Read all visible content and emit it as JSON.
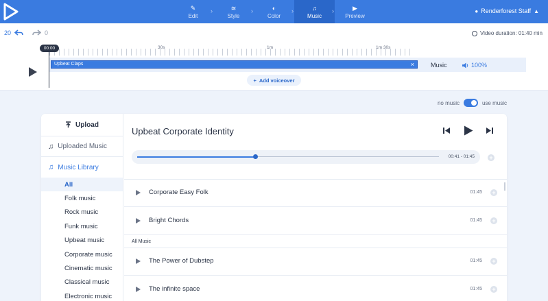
{
  "nav": {
    "steps": [
      {
        "label": "Edit",
        "icon": "pencil-icon",
        "glyph": "✎"
      },
      {
        "label": "Style",
        "icon": "layers-icon",
        "glyph": "≋"
      },
      {
        "label": "Color",
        "icon": "palette-icon",
        "glyph": "◐"
      },
      {
        "label": "Music",
        "icon": "music-note-icon",
        "glyph": "♫",
        "active": true
      },
      {
        "label": "Preview",
        "icon": "play-icon",
        "glyph": "▶"
      }
    ],
    "separator": "›",
    "user_name": "Renderforest Staff",
    "user_icon": "▲"
  },
  "history": {
    "undo_count": "20",
    "redo_count": "0"
  },
  "video_duration": "Video duration: 01:40 min",
  "timeline": {
    "current_time": "00:00",
    "marks": [
      "30s",
      "1m",
      "1m 30s"
    ],
    "clip_name": "Upbeat Claps",
    "clip_close": "×",
    "track_label": "Music",
    "volume": "100%",
    "add_voiceover": "Add voiceover"
  },
  "music_toggle": {
    "off_label": "no music",
    "on_label": "use music",
    "enabled": true
  },
  "sidebar": {
    "upload": "Upload",
    "uploaded_music": "Uploaded Music",
    "music_library": "Music Library",
    "categories": [
      "All",
      "Folk music",
      "Rock music",
      "Funk music",
      "Upbeat music",
      "Corporate music",
      "Cinematic music",
      "Classical music",
      "Electronic music"
    ]
  },
  "player": {
    "title": "Upbeat Corporate Identity",
    "time_range": "00:41 - 01:45",
    "progress": 0.39
  },
  "tracks_top": [
    {
      "name": "Corporate Easy Folk",
      "duration": "01:45"
    },
    {
      "name": "Bright Chords",
      "duration": "01:45"
    }
  ],
  "section_label": "All Music",
  "tracks_all": [
    {
      "name": "The Power of Dubstep",
      "duration": "01:45"
    },
    {
      "name": "The infinite space",
      "duration": "01:45"
    }
  ],
  "plus_glyph": "+",
  "colors": {
    "accent": "#3a7be0",
    "nav_bg": "#3a7be0",
    "nav_active": "#2a67c9",
    "page_bg": "#eef3fb"
  }
}
